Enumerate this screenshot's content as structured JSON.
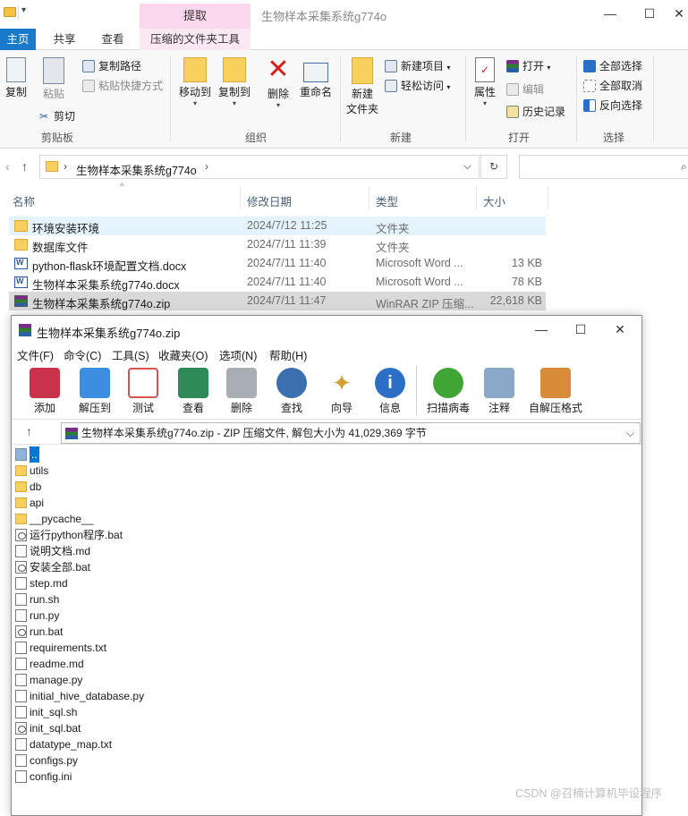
{
  "titlebar": {
    "context_tab": "提取",
    "window_title": "生物样本采集系统g774o",
    "minimize": "—",
    "maximize": "☐",
    "close": "✕"
  },
  "ribbon_tabs": {
    "home": "主页",
    "share": "共享",
    "view": "查看",
    "compressed_tools": "压缩的文件夹工具"
  },
  "ribbon": {
    "clipboard": {
      "copy": "复制",
      "paste": "粘贴",
      "copy_path": "复制路径",
      "paste_shortcut": "粘贴快捷方式",
      "cut": "剪切",
      "label": "剪贴板"
    },
    "organize": {
      "move_to": "移动到",
      "copy_to": "复制到",
      "delete": "删除",
      "rename": "重命名",
      "label": "组织"
    },
    "new": {
      "new_folder_line1": "新建",
      "new_folder_line2": "文件夹",
      "new_item": "新建项目",
      "easy_access": "轻松访问",
      "label": "新建"
    },
    "open": {
      "properties": "属性",
      "open": "打开",
      "edit": "编辑",
      "history": "历史记录",
      "label": "打开"
    },
    "select": {
      "select_all": "全部选择",
      "select_none": "全部取消",
      "invert": "反向选择",
      "label": "选择"
    }
  },
  "address": {
    "path": "生物样本采集系统g774o",
    "refresh": "↻"
  },
  "columns": {
    "name": "名称",
    "date": "修改日期",
    "type": "类型",
    "size": "大小"
  },
  "files": [
    {
      "name": "环境安装环境",
      "date": "2024/7/12 11:25",
      "type": "文件夹",
      "size": "",
      "icon": "folder-icon"
    },
    {
      "name": "数据库文件",
      "date": "2024/7/11 11:39",
      "type": "文件夹",
      "size": "",
      "icon": "folder-icon"
    },
    {
      "name": "python-flask环境配置文档.docx",
      "date": "2024/7/11 11:40",
      "type": "Microsoft Word ...",
      "size": "13 KB",
      "icon": "word-icon"
    },
    {
      "name": "生物样本采集系统g774o.docx",
      "date": "2024/7/11 11:40",
      "type": "Microsoft Word ...",
      "size": "78 KB",
      "icon": "word-icon"
    },
    {
      "name": "生物样本采集系统g774o.zip",
      "date": "2024/7/11 11:47",
      "type": "WinRAR ZIP 压缩...",
      "size": "22,618 KB",
      "icon": "winrar-icon"
    }
  ],
  "rar": {
    "title": "生物样本采集系统g774o.zip",
    "menu": [
      "文件(F)",
      "命令(C)",
      "工具(S)",
      "收藏夹(O)",
      "选项(N)",
      "帮助(H)"
    ],
    "tools": [
      {
        "label": "添加",
        "icon": "add-archive-icon",
        "color": "#c8334a"
      },
      {
        "label": "解压到",
        "icon": "extract-to-icon",
        "color": "#3d8de0"
      },
      {
        "label": "测试",
        "icon": "test-icon",
        "color": "#d9534f"
      },
      {
        "label": "查看",
        "icon": "view-book-icon",
        "color": "#2e8b57"
      },
      {
        "label": "删除",
        "icon": "trash-icon",
        "color": "#8a8f96"
      },
      {
        "label": "查找",
        "icon": "magnifier-icon",
        "color": "#3a6fb0"
      },
      {
        "label": "向导",
        "icon": "wizard-wand-icon",
        "color": "#d0a030"
      },
      {
        "label": "信息",
        "icon": "info-icon",
        "color": "#2a6ec6"
      },
      {
        "label": "扫描病毒",
        "icon": "virus-scan-icon",
        "color": "#3fa535"
      },
      {
        "label": "注释",
        "icon": "comment-icon",
        "color": "#8aa9c8"
      },
      {
        "label": "自解压格式",
        "icon": "sfx-box-icon",
        "color": "#d88c3a"
      }
    ],
    "path": "生物样本采集系统g774o.zip - ZIP 压缩文件, 解包大小为 41,029,369 字节",
    "entries": [
      {
        "name": "..",
        "kind": "up"
      },
      {
        "name": "utils",
        "kind": "fold"
      },
      {
        "name": "db",
        "kind": "fold"
      },
      {
        "name": "api",
        "kind": "fold"
      },
      {
        "name": "__pycache__",
        "kind": "fold"
      },
      {
        "name": "运行python程序.bat",
        "kind": "bat"
      },
      {
        "name": "说明文档.md",
        "kind": "doc"
      },
      {
        "name": "安装全部.bat",
        "kind": "bat"
      },
      {
        "name": "step.md",
        "kind": "doc"
      },
      {
        "name": "run.sh",
        "kind": "doc"
      },
      {
        "name": "run.py",
        "kind": "doc"
      },
      {
        "name": "run.bat",
        "kind": "bat"
      },
      {
        "name": "requirements.txt",
        "kind": "doc"
      },
      {
        "name": "readme.md",
        "kind": "doc"
      },
      {
        "name": "manage.py",
        "kind": "doc"
      },
      {
        "name": "initial_hive_database.py",
        "kind": "doc"
      },
      {
        "name": "init_sql.sh",
        "kind": "doc"
      },
      {
        "name": "init_sql.bat",
        "kind": "bat"
      },
      {
        "name": "datatype_map.txt",
        "kind": "doc"
      },
      {
        "name": "configs.py",
        "kind": "doc"
      },
      {
        "name": "config.ini",
        "kind": "doc"
      }
    ]
  },
  "watermark": "CSDN @召楠计算机毕设程序"
}
